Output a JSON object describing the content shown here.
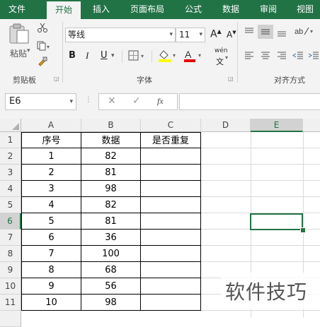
{
  "ribbon": {
    "tabs": [
      "文件",
      "开始",
      "插入",
      "页面布局",
      "公式",
      "数据",
      "审阅",
      "视图"
    ],
    "active_tab": "开始",
    "clipboard": {
      "paste_label": "粘贴",
      "group_label": "剪贴板"
    },
    "font": {
      "font_name": "等线",
      "font_size": "11",
      "grow_label": "A",
      "shrink_label": "A",
      "bold_label": "B",
      "italic_label": "I",
      "underline_label": "U",
      "font_color_label": "A",
      "phonetic_label": "wén",
      "group_label": "字体"
    },
    "alignment": {
      "group_label": "对齐方式"
    },
    "colors": {
      "ribbon_green": "#217346",
      "highlight_yellow": "#ffff00",
      "font_red": "#ff0000"
    }
  },
  "formula_bar": {
    "name_box": "E6",
    "fx_label": "fx",
    "formula": ""
  },
  "grid": {
    "columns": [
      "A",
      "B",
      "C",
      "D",
      "E"
    ],
    "active_cell": "E6",
    "header": [
      "序号",
      "数据",
      "是否重复"
    ],
    "rows": [
      {
        "num": "1",
        "a": "序号",
        "b": "数据",
        "c": "是否重复"
      },
      {
        "num": "2",
        "a": "1",
        "b": "82",
        "c": ""
      },
      {
        "num": "3",
        "a": "2",
        "b": "81",
        "c": ""
      },
      {
        "num": "4",
        "a": "3",
        "b": "98",
        "c": ""
      },
      {
        "num": "5",
        "a": "4",
        "b": "82",
        "c": ""
      },
      {
        "num": "6",
        "a": "5",
        "b": "81",
        "c": ""
      },
      {
        "num": "7",
        "a": "6",
        "b": "36",
        "c": ""
      },
      {
        "num": "8",
        "a": "7",
        "b": "100",
        "c": ""
      },
      {
        "num": "9",
        "a": "8",
        "b": "68",
        "c": ""
      },
      {
        "num": "10",
        "a": "9",
        "b": "56",
        "c": ""
      },
      {
        "num": "11",
        "a": "10",
        "b": "98",
        "c": ""
      }
    ]
  },
  "watermark": "软件技巧"
}
